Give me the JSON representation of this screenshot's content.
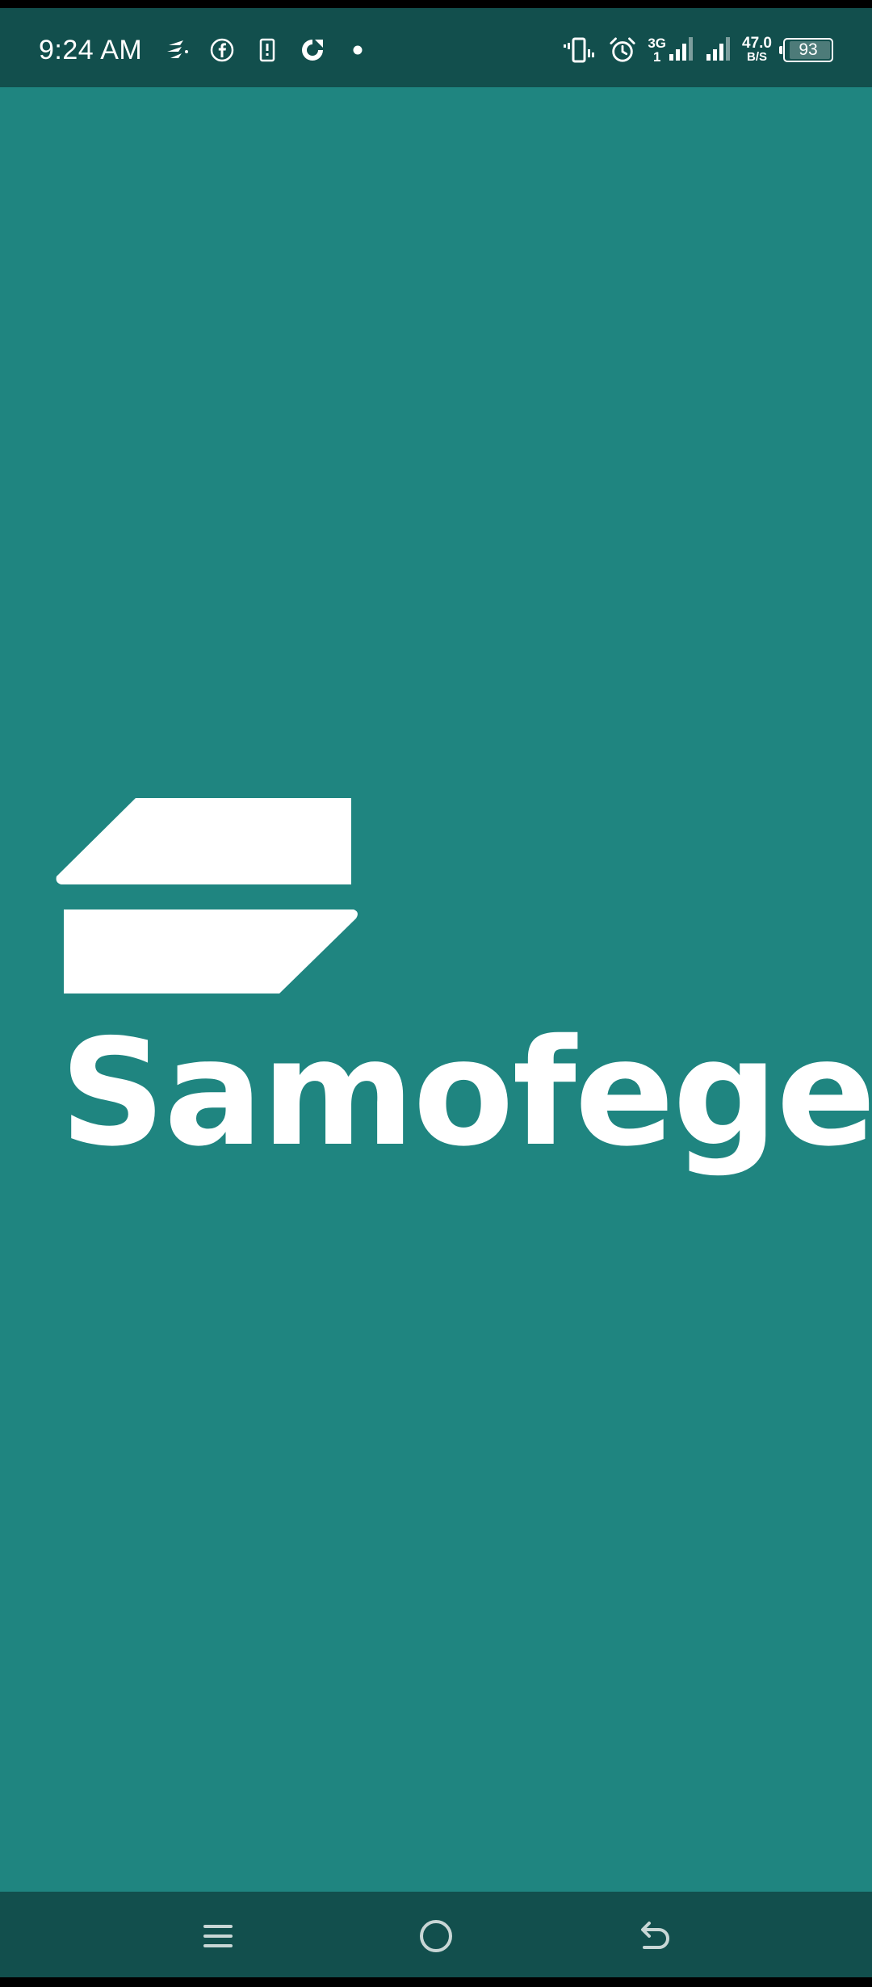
{
  "status_bar": {
    "time": "9:24 AM",
    "notification_icons": [
      "data-saver-icon",
      "facebook-icon",
      "phone-clipboard-icon",
      "sync-circle-icon",
      "dot-icon"
    ],
    "network_type": "3G",
    "network_sub": "1",
    "net_speed_value": "47.0",
    "net_speed_unit": "B/S",
    "battery_level": "93",
    "battery_percent": 93
  },
  "logo": {
    "app_name": "Samofege"
  },
  "nav_bar": {
    "buttons": [
      "menu",
      "home",
      "back"
    ]
  },
  "colors": {
    "background": "#1f8580",
    "bars": "#124f4d",
    "foreground": "#ffffff"
  }
}
